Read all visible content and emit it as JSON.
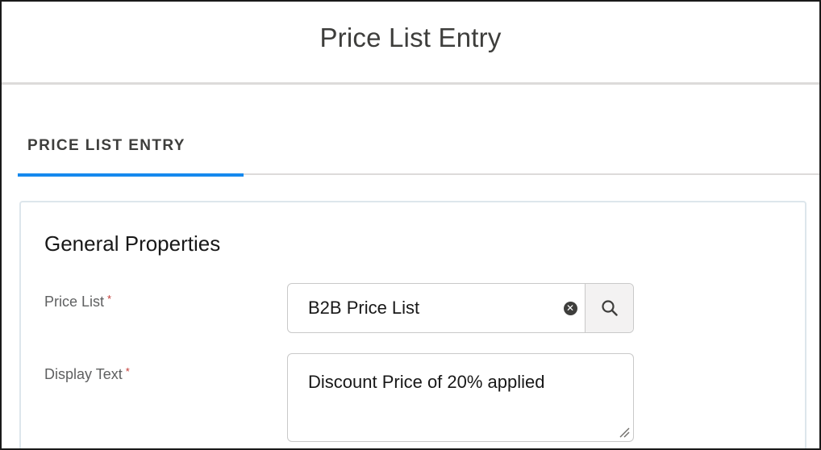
{
  "modal": {
    "title": "Price List Entry"
  },
  "tabs": [
    {
      "label": "PRICE LIST ENTRY",
      "active": true
    }
  ],
  "section": {
    "title": "General Properties"
  },
  "fields": {
    "price_list": {
      "label": "Price List",
      "required_marker": "*",
      "value": "B2B Price List"
    },
    "display_text": {
      "label": "Display Text",
      "required_marker": "*",
      "value": "Discount Price of 20% applied"
    }
  },
  "icons": {
    "clear": "clear-icon",
    "search": "search-icon",
    "resize": "resize-handle-icon"
  },
  "colors": {
    "accent": "#1589ee",
    "required": "#c23934",
    "border": "#c9c9c9"
  }
}
